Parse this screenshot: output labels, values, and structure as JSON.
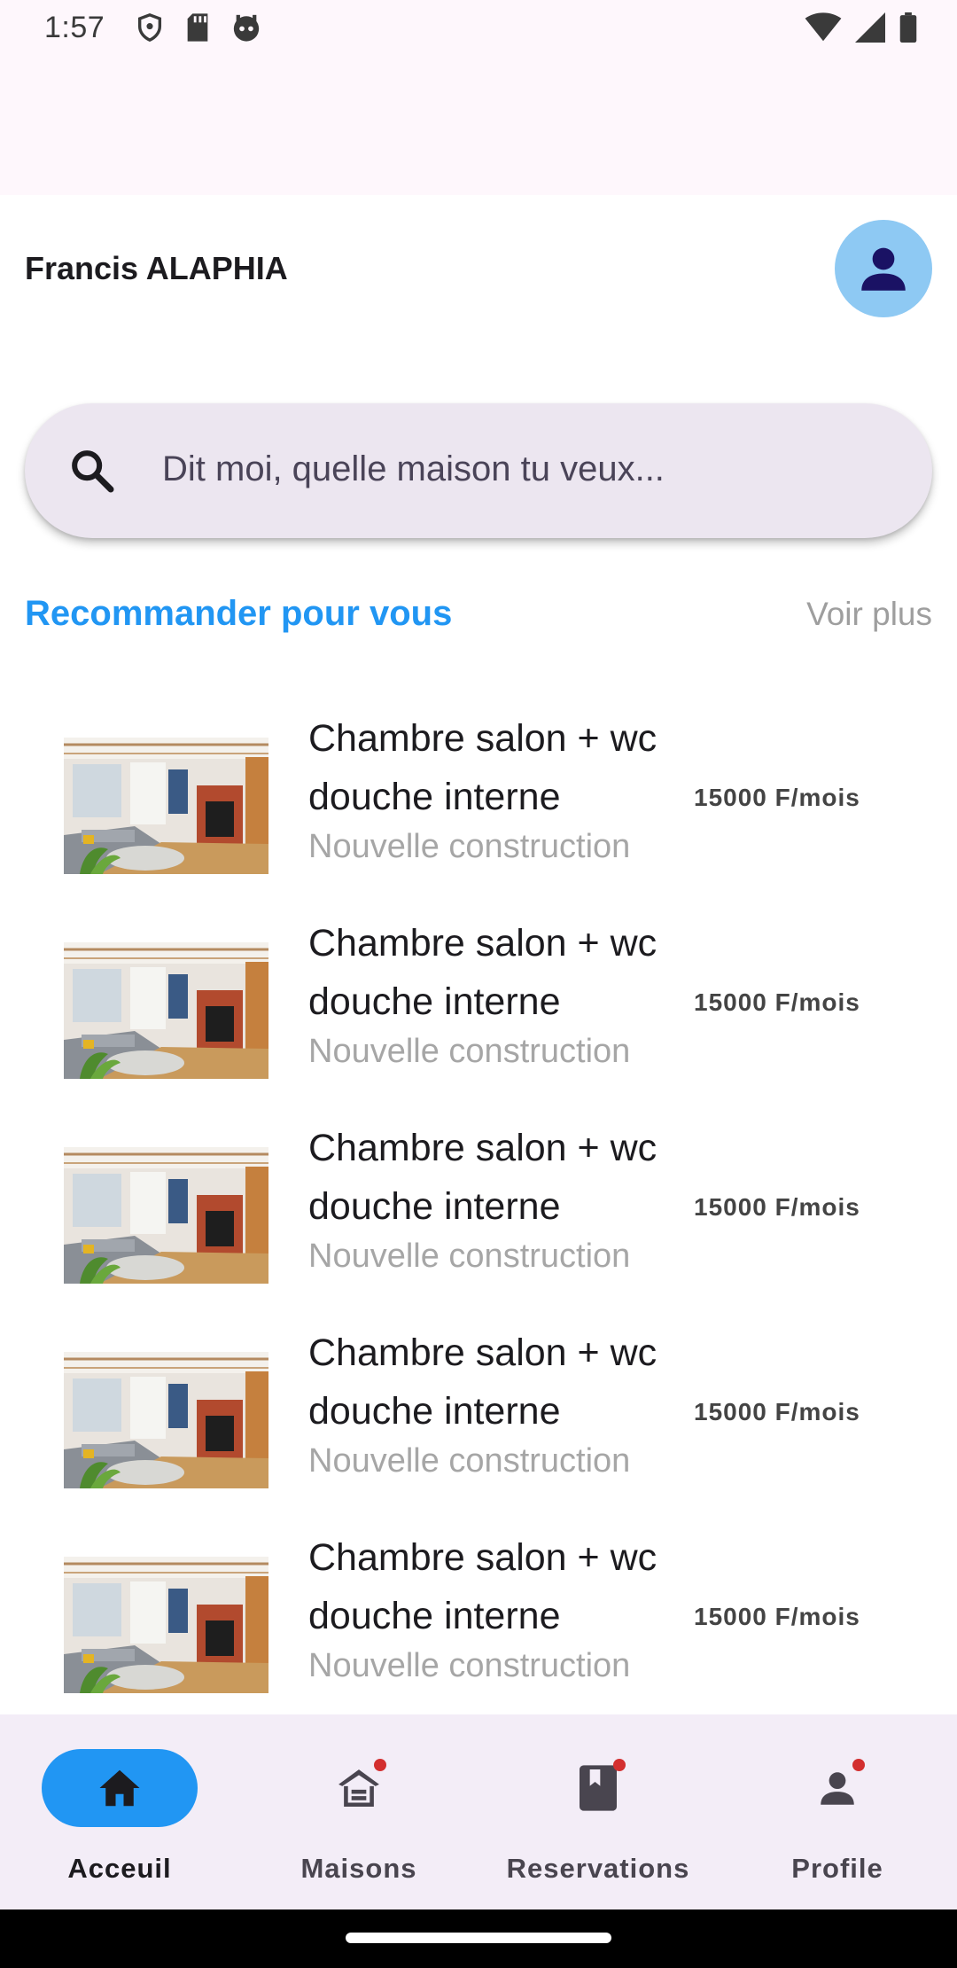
{
  "status_bar": {
    "time": "1:57",
    "left_icons": [
      "shield-icon",
      "sd-card-icon",
      "robot-icon"
    ],
    "right_icons": [
      "wifi-icon",
      "signal-icon",
      "battery-icon"
    ]
  },
  "header": {
    "user_name": "Francis ALAPHIA",
    "avatar_icon": "person-icon"
  },
  "search": {
    "placeholder": "Dit moi, quelle maison tu veux...",
    "icon": "search-icon"
  },
  "section": {
    "title": "Recommander pour vous",
    "see_more": "Voir plus"
  },
  "listings": [
    {
      "title": "Chambre salon + wc douche interne",
      "subtitle": "Nouvelle construction",
      "price": "15000 F/mois"
    },
    {
      "title": "Chambre salon + wc douche interne",
      "subtitle": "Nouvelle construction",
      "price": "15000 F/mois"
    },
    {
      "title": "Chambre salon + wc douche interne",
      "subtitle": "Nouvelle construction",
      "price": "15000 F/mois"
    },
    {
      "title": "Chambre salon + wc douche interne",
      "subtitle": "Nouvelle construction",
      "price": "15000 F/mois"
    },
    {
      "title": "Chambre salon + wc douche interne",
      "subtitle": "Nouvelle construction",
      "price": "15000 F/mois"
    }
  ],
  "bottom_nav": [
    {
      "label": "Acceuil",
      "icon": "home-icon",
      "active": true,
      "badge": false
    },
    {
      "label": "Maisons",
      "icon": "house-icon",
      "active": false,
      "badge": true
    },
    {
      "label": "Reservations",
      "icon": "bookmark-book-icon",
      "active": false,
      "badge": true
    },
    {
      "label": "Profile",
      "icon": "person-icon",
      "active": false,
      "badge": true
    }
  ],
  "colors": {
    "accent": "#2196f3",
    "avatar_bg": "#8ec9f3",
    "search_bg": "#ece6f0",
    "nav_bg": "#f3edf7",
    "badge": "#d32f2f"
  }
}
